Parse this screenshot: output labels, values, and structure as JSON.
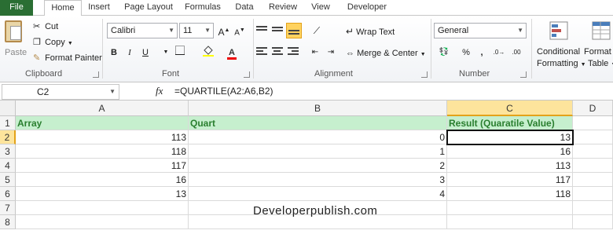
{
  "tabs": [
    "File",
    "Home",
    "Insert",
    "Page Layout",
    "Formulas",
    "Data",
    "Review",
    "View",
    "Developer"
  ],
  "clipboard": {
    "paste": "Paste",
    "cut": "Cut",
    "copy": "Copy",
    "format_painter": "Format Painter",
    "group": "Clipboard"
  },
  "font": {
    "name": "Calibri",
    "size": "11",
    "group": "Font",
    "bold": "B",
    "italic": "I",
    "underline": "U"
  },
  "alignment": {
    "wrap": "Wrap Text",
    "merge": "Merge & Center",
    "group": "Alignment"
  },
  "number": {
    "format": "General",
    "percent": "%",
    "comma": ",",
    "group": "Number"
  },
  "styles": {
    "conditional_1": "Conditional",
    "conditional_2": "Formatting",
    "format_1": "Format a",
    "format_2": "Table"
  },
  "formula_bar": {
    "name_box": "C2",
    "fx": "fx",
    "formula": "=QUARTILE(A2:A6,B2)"
  },
  "columns": [
    "A",
    "B",
    "C",
    "D"
  ],
  "rows": [
    "1",
    "2",
    "3",
    "4",
    "5",
    "6",
    "7",
    "8"
  ],
  "headers": {
    "a": "Array",
    "b": "Quart",
    "c": "Result (Quaratile Value)"
  },
  "data": [
    {
      "a": "113",
      "b": "0",
      "c": "13"
    },
    {
      "a": "118",
      "b": "1",
      "c": "16"
    },
    {
      "a": "117",
      "b": "2",
      "c": "113"
    },
    {
      "a": "16",
      "b": "3",
      "c": "117"
    },
    {
      "a": "13",
      "b": "4",
      "c": "118"
    }
  ],
  "watermark": "Developerpublish.com",
  "colors": {
    "file_tab": "#2a6e33",
    "header_fill": "#c6efce",
    "header_text": "#2a7f2f",
    "selection": "#fde49c"
  }
}
